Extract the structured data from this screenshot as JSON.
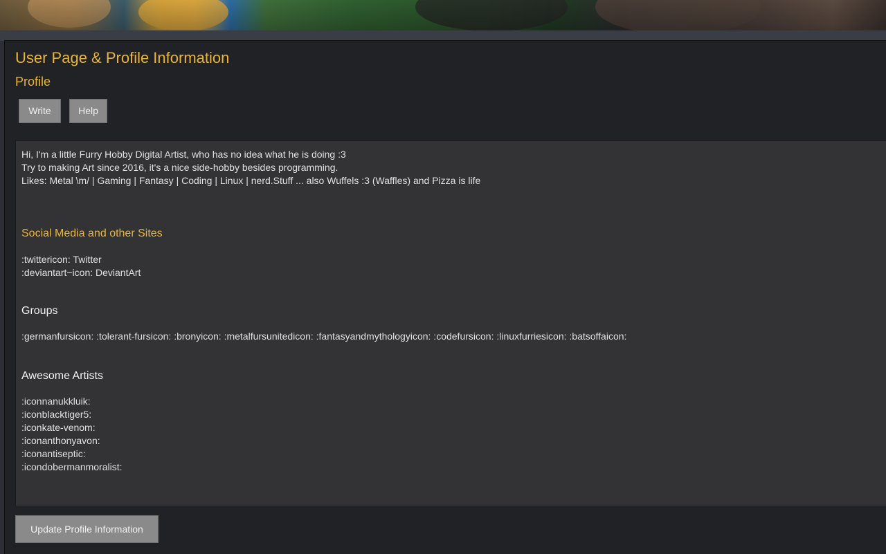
{
  "page": {
    "title": "User Page & Profile Information",
    "section_title": "Profile"
  },
  "tabs": {
    "write_label": "Write",
    "help_label": "Help"
  },
  "editor": {
    "intro_lines": [
      "Hi, I'm a little Furry Hobby Digital Artist, who has no idea what he is doing :3",
      "Try to making Art since 2016, it's a nice side-hobby besides programming.",
      "Likes: Metal \\m/ | Gaming | Fantasy | Coding | Linux | nerd.Stuff ... also Wuffels :3 (Waffles) and Pizza is life"
    ],
    "social_heading": "Social Media and other Sites",
    "social_lines": [
      ":twittericon: Twitter",
      ":deviantart~icon: DeviantArt"
    ],
    "groups_heading": "Groups",
    "groups_line": ":germanfursicon: :tolerant-fursicon: :bronyicon: :metalfursunitedicon: :fantasyandmythologyicon: :codefursicon: :linuxfurriesicon: :batsoffaicon:",
    "artists_heading": "Awesome Artists",
    "artist_lines": [
      ":iconnanukkluik:",
      ":iconblacktiger5:",
      ":iconkate-venom:",
      ":iconanthonyavon:",
      ":iconantiseptic:",
      ":icondobermanmoralist:"
    ]
  },
  "actions": {
    "update_label": "Update Profile Information"
  },
  "colors": {
    "accent": "#e8b53a",
    "panel_bg": "#212226",
    "editor_bg": "#333335",
    "button_bg": "#8a8a8a"
  }
}
